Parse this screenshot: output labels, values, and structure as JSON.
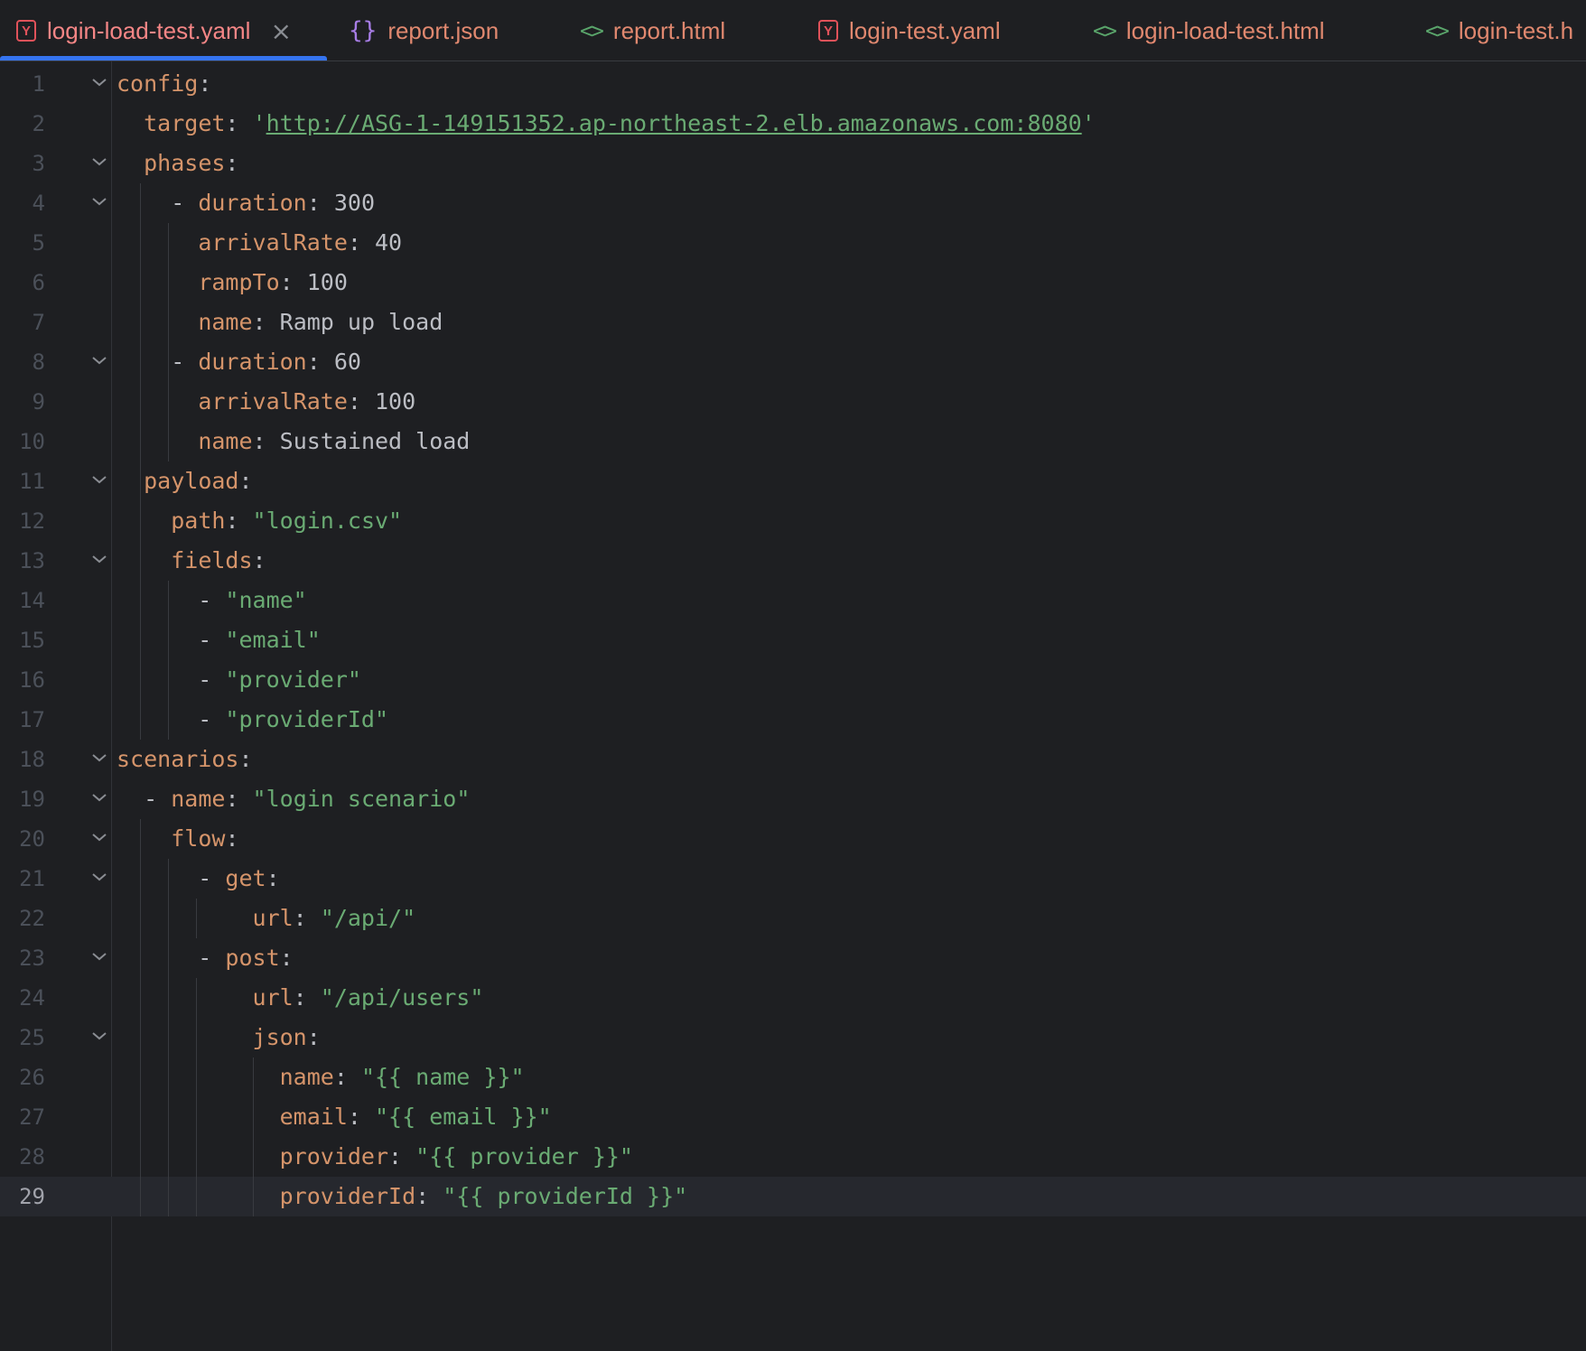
{
  "tabs": [
    {
      "label": "login-load-test.yaml",
      "icon": "yaml-icon",
      "active": true,
      "closable": true
    },
    {
      "label": "report.json",
      "icon": "json-icon",
      "active": false
    },
    {
      "label": "report.html",
      "icon": "html-icon",
      "active": false
    },
    {
      "label": "login-test.yaml",
      "icon": "yaml-icon",
      "active": false
    },
    {
      "label": "login-load-test.html",
      "icon": "html-icon",
      "active": false
    },
    {
      "label": "login-test.h",
      "icon": "html-icon",
      "active": false
    }
  ],
  "colors": {
    "background": "#1e1f22",
    "key": "#d5946a",
    "string": "#6aab73",
    "plain": "#bcbec4",
    "accent": "#3574f0"
  },
  "current_line": 29,
  "lines": [
    {
      "n": "1",
      "fold": true,
      "tokens": [
        {
          "t": "k",
          "v": "config"
        },
        {
          "t": "p",
          "v": ":"
        }
      ]
    },
    {
      "n": "2",
      "fold": false,
      "tokens": [
        {
          "t": "p",
          "v": "  "
        },
        {
          "t": "k",
          "v": "target"
        },
        {
          "t": "p",
          "v": ": "
        },
        {
          "t": "s",
          "v": "'"
        },
        {
          "t": "url",
          "v": "http://ASG-1-149151352.ap-northeast-2.elb.amazonaws.com:8080"
        },
        {
          "t": "s",
          "v": "'"
        }
      ]
    },
    {
      "n": "3",
      "fold": true,
      "tokens": [
        {
          "t": "p",
          "v": "  "
        },
        {
          "t": "k",
          "v": "phases"
        },
        {
          "t": "p",
          "v": ":"
        }
      ]
    },
    {
      "n": "4",
      "fold": true,
      "tokens": [
        {
          "t": "p",
          "v": "    - "
        },
        {
          "t": "k",
          "v": "duration"
        },
        {
          "t": "p",
          "v": ": "
        },
        {
          "t": "v",
          "v": "300"
        }
      ]
    },
    {
      "n": "5",
      "fold": false,
      "tokens": [
        {
          "t": "p",
          "v": "      "
        },
        {
          "t": "k",
          "v": "arrivalRate"
        },
        {
          "t": "p",
          "v": ": "
        },
        {
          "t": "v",
          "v": "40"
        }
      ]
    },
    {
      "n": "6",
      "fold": false,
      "tokens": [
        {
          "t": "p",
          "v": "      "
        },
        {
          "t": "k",
          "v": "rampTo"
        },
        {
          "t": "p",
          "v": ": "
        },
        {
          "t": "v",
          "v": "100"
        }
      ]
    },
    {
      "n": "7",
      "fold": false,
      "tokens": [
        {
          "t": "p",
          "v": "      "
        },
        {
          "t": "k",
          "v": "name"
        },
        {
          "t": "p",
          "v": ": "
        },
        {
          "t": "v",
          "v": "Ramp up load"
        }
      ]
    },
    {
      "n": "8",
      "fold": true,
      "tokens": [
        {
          "t": "p",
          "v": "    - "
        },
        {
          "t": "k",
          "v": "duration"
        },
        {
          "t": "p",
          "v": ": "
        },
        {
          "t": "v",
          "v": "60"
        }
      ]
    },
    {
      "n": "9",
      "fold": false,
      "tokens": [
        {
          "t": "p",
          "v": "      "
        },
        {
          "t": "k",
          "v": "arrivalRate"
        },
        {
          "t": "p",
          "v": ": "
        },
        {
          "t": "v",
          "v": "100"
        }
      ]
    },
    {
      "n": "10",
      "fold": false,
      "tokens": [
        {
          "t": "p",
          "v": "      "
        },
        {
          "t": "k",
          "v": "name"
        },
        {
          "t": "p",
          "v": ": "
        },
        {
          "t": "v",
          "v": "Sustained load"
        }
      ]
    },
    {
      "n": "11",
      "fold": true,
      "tokens": [
        {
          "t": "p",
          "v": "  "
        },
        {
          "t": "k",
          "v": "payload"
        },
        {
          "t": "p",
          "v": ":"
        }
      ]
    },
    {
      "n": "12",
      "fold": false,
      "tokens": [
        {
          "t": "p",
          "v": "    "
        },
        {
          "t": "k",
          "v": "path"
        },
        {
          "t": "p",
          "v": ": "
        },
        {
          "t": "s",
          "v": "\"login.csv\""
        }
      ]
    },
    {
      "n": "13",
      "fold": true,
      "tokens": [
        {
          "t": "p",
          "v": "    "
        },
        {
          "t": "k",
          "v": "fields"
        },
        {
          "t": "p",
          "v": ":"
        }
      ]
    },
    {
      "n": "14",
      "fold": false,
      "tokens": [
        {
          "t": "p",
          "v": "      - "
        },
        {
          "t": "s",
          "v": "\"name\""
        }
      ]
    },
    {
      "n": "15",
      "fold": false,
      "tokens": [
        {
          "t": "p",
          "v": "      - "
        },
        {
          "t": "s",
          "v": "\"email\""
        }
      ]
    },
    {
      "n": "16",
      "fold": false,
      "tokens": [
        {
          "t": "p",
          "v": "      - "
        },
        {
          "t": "s",
          "v": "\"provider\""
        }
      ]
    },
    {
      "n": "17",
      "fold": false,
      "tokens": [
        {
          "t": "p",
          "v": "      - "
        },
        {
          "t": "s",
          "v": "\"providerId\""
        }
      ]
    },
    {
      "n": "18",
      "fold": true,
      "tokens": [
        {
          "t": "k",
          "v": "scenarios"
        },
        {
          "t": "p",
          "v": ":"
        }
      ]
    },
    {
      "n": "19",
      "fold": true,
      "tokens": [
        {
          "t": "p",
          "v": "  - "
        },
        {
          "t": "k",
          "v": "name"
        },
        {
          "t": "p",
          "v": ": "
        },
        {
          "t": "s",
          "v": "\"login scenario\""
        }
      ]
    },
    {
      "n": "20",
      "fold": true,
      "tokens": [
        {
          "t": "p",
          "v": "    "
        },
        {
          "t": "k",
          "v": "flow"
        },
        {
          "t": "p",
          "v": ":"
        }
      ]
    },
    {
      "n": "21",
      "fold": true,
      "tokens": [
        {
          "t": "p",
          "v": "      - "
        },
        {
          "t": "k",
          "v": "get"
        },
        {
          "t": "p",
          "v": ":"
        }
      ]
    },
    {
      "n": "22",
      "fold": false,
      "tokens": [
        {
          "t": "p",
          "v": "          "
        },
        {
          "t": "k",
          "v": "url"
        },
        {
          "t": "p",
          "v": ": "
        },
        {
          "t": "s",
          "v": "\"/api/\""
        }
      ]
    },
    {
      "n": "23",
      "fold": true,
      "tokens": [
        {
          "t": "p",
          "v": "      - "
        },
        {
          "t": "k",
          "v": "post"
        },
        {
          "t": "p",
          "v": ":"
        }
      ]
    },
    {
      "n": "24",
      "fold": false,
      "tokens": [
        {
          "t": "p",
          "v": "          "
        },
        {
          "t": "k",
          "v": "url"
        },
        {
          "t": "p",
          "v": ": "
        },
        {
          "t": "s",
          "v": "\"/api/users\""
        }
      ]
    },
    {
      "n": "25",
      "fold": true,
      "tokens": [
        {
          "t": "p",
          "v": "          "
        },
        {
          "t": "k",
          "v": "json"
        },
        {
          "t": "p",
          "v": ":"
        }
      ]
    },
    {
      "n": "26",
      "fold": false,
      "tokens": [
        {
          "t": "p",
          "v": "            "
        },
        {
          "t": "k",
          "v": "name"
        },
        {
          "t": "p",
          "v": ": "
        },
        {
          "t": "s",
          "v": "\"{{ name }}\""
        }
      ]
    },
    {
      "n": "27",
      "fold": false,
      "tokens": [
        {
          "t": "p",
          "v": "            "
        },
        {
          "t": "k",
          "v": "email"
        },
        {
          "t": "p",
          "v": ": "
        },
        {
          "t": "s",
          "v": "\"{{ email }}\""
        }
      ]
    },
    {
      "n": "28",
      "fold": false,
      "tokens": [
        {
          "t": "p",
          "v": "            "
        },
        {
          "t": "k",
          "v": "provider"
        },
        {
          "t": "p",
          "v": ": "
        },
        {
          "t": "s",
          "v": "\"{{ provider }}\""
        }
      ]
    },
    {
      "n": "29",
      "fold": false,
      "tokens": [
        {
          "t": "p",
          "v": "            "
        },
        {
          "t": "k",
          "v": "providerId"
        },
        {
          "t": "p",
          "v": ": "
        },
        {
          "t": "s",
          "v": "\"{{ providerId }}\""
        }
      ]
    }
  ]
}
